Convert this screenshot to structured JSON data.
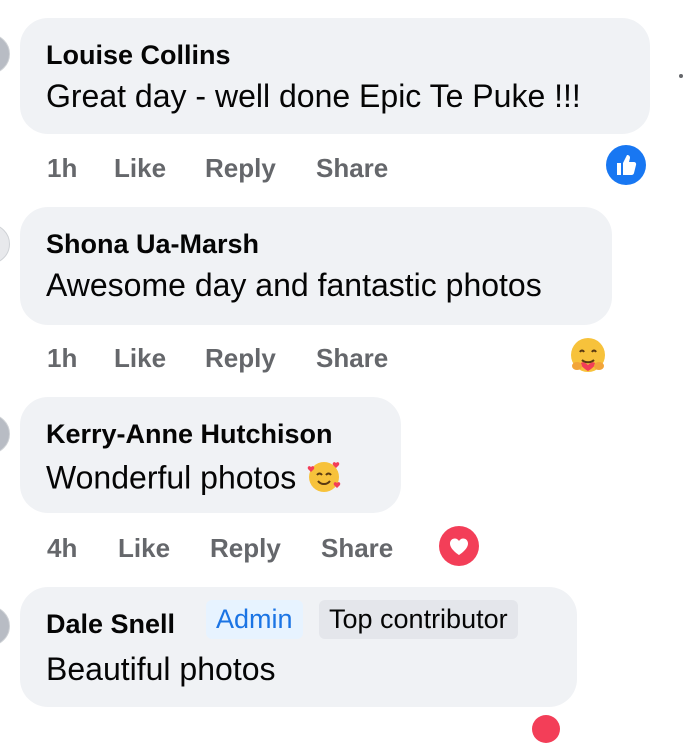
{
  "comments": [
    {
      "author": "Louise Collins",
      "text": "Great day - well done Epic Te Puke !!!",
      "time": "1h",
      "like": "Like",
      "reply": "Reply",
      "share": "Share",
      "reaction": "thumbs-up-icon"
    },
    {
      "author": "Shona Ua-Marsh",
      "text": "Awesome day and fantastic photos",
      "time": "1h",
      "like": "Like",
      "reply": "Reply",
      "share": "Share",
      "reaction": "hug-emoji-icon"
    },
    {
      "author": "Kerry-Anne Hutchison",
      "text": "Wonderful photos",
      "time": "4h",
      "like": "Like",
      "reply": "Reply",
      "share": "Share",
      "reaction": "heart-icon"
    },
    {
      "author": "Dale Snell",
      "badges": [
        "Admin",
        "Top contributor"
      ],
      "text": "Beautiful photos"
    }
  ],
  "colors": {
    "bubble": "#f0f2f5",
    "like_blue": "#1877f2",
    "heart_red": "#f33e58",
    "admin_blue": "#1b74e4",
    "meta_gray": "#65676b"
  }
}
